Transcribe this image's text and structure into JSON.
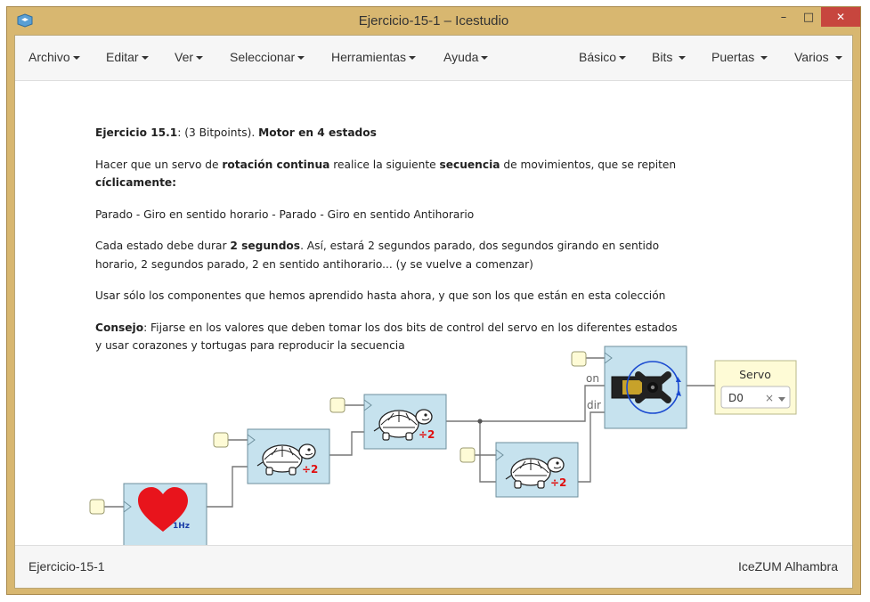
{
  "window": {
    "title": "Ejercicio-15-1 – Icestudio",
    "controls": {
      "minimize": "–",
      "maximize": "□",
      "close": "✕"
    }
  },
  "menubar": {
    "left": [
      {
        "label": "Archivo"
      },
      {
        "label": "Editar"
      },
      {
        "label": "Ver"
      },
      {
        "label": "Seleccionar"
      },
      {
        "label": "Herramientas"
      },
      {
        "label": "Ayuda"
      }
    ],
    "right": [
      {
        "label": "Básico"
      },
      {
        "label": "Bits"
      },
      {
        "label": "Puertas"
      },
      {
        "label": "Varios"
      }
    ]
  },
  "description": {
    "p1": {
      "a": "Ejercicio 15.1",
      "b": ": (3 Bitpoints). ",
      "c": "Motor en 4 estados"
    },
    "p2": {
      "a": "Hacer que un servo de ",
      "b": "rotación continua",
      "c": " realice la siguiente ",
      "d": "secuencia",
      "e": " de movimientos, que se repiten ",
      "f": "cíclicamente",
      "g": ":"
    },
    "p3": "Parado - Giro en sentido horario - Parado - Giro en sentido Antihorario",
    "p4": {
      "a": "Cada estado debe durar ",
      "b": "2 segundos",
      "c": ". Así, estará 2 segundos parado, dos segundos girando en sentido horario, 2 segundos parado, 2 en sentido antihorario... (y se vuelve a comenzar)"
    },
    "p5": "Usar sólo los componentes que hemos aprendido hasta ahora, y que son los que están en esta colección",
    "p6": {
      "a": "Consejo",
      "b": ": Fijarse en los valores que deben tomar los dos bits de control del servo en los diferentes estados y usar corazones y tortugas para reproducir la secuencia"
    }
  },
  "circuit": {
    "heart_label": "1Hz",
    "divider_label": "÷2",
    "servo_ports": {
      "on": "on",
      "dir": "dir"
    },
    "output": {
      "title": "Servo",
      "pin": "D0",
      "clear": "×"
    }
  },
  "statusbar": {
    "left": "Ejercicio-15-1",
    "right": "IceZUM Alhambra"
  },
  "colors": {
    "frame": "#d8b770",
    "close_button": "#c7463e",
    "block_fill": "#c6e2ee",
    "block_stroke": "#6d8f9c",
    "output_fill": "#fefbd6",
    "heart": "#e8141c"
  }
}
